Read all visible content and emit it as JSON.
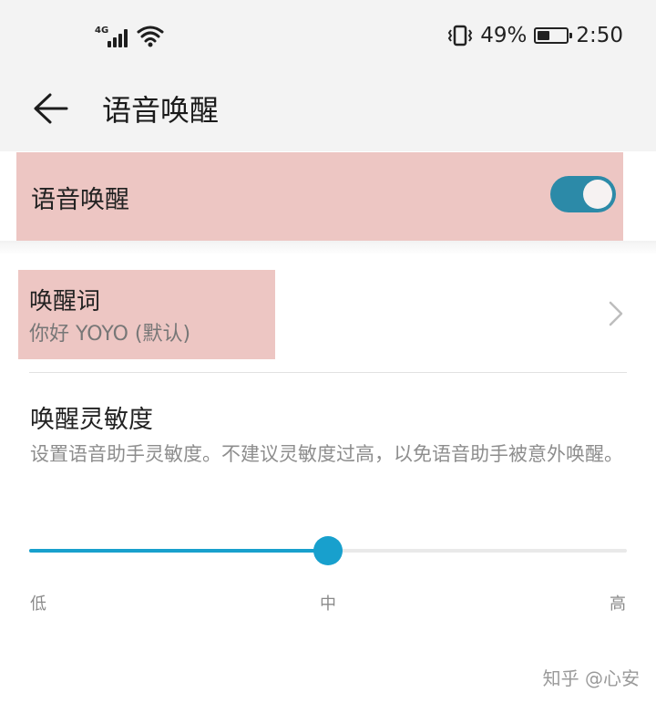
{
  "status_bar": {
    "network": "4G",
    "battery_text": "49%",
    "battery_level": 0.49,
    "time": "2:50",
    "icons": [
      "signal-icon",
      "wifi-icon",
      "vibrate-icon",
      "battery-icon"
    ]
  },
  "header": {
    "title": "语音唤醒",
    "back_icon": "back-arrow-icon"
  },
  "voice_wake": {
    "label": "语音唤醒",
    "enabled": true
  },
  "wake_word": {
    "title": "唤醒词",
    "value": "你好 YOYO (默认)",
    "icon": "chevron-right-icon"
  },
  "sensitivity": {
    "title": "唤醒灵敏度",
    "description": "设置语音助手灵敏度。不建议灵敏度过高，以免语音助手被意外唤醒。",
    "value": 0.5,
    "labels": {
      "low": "低",
      "mid": "中",
      "high": "高"
    }
  },
  "watermark": "知乎 @心安",
  "colors": {
    "accent": "#18a0cd",
    "toggle_on": "#2c8aa8",
    "highlight": "#edc6c3"
  }
}
